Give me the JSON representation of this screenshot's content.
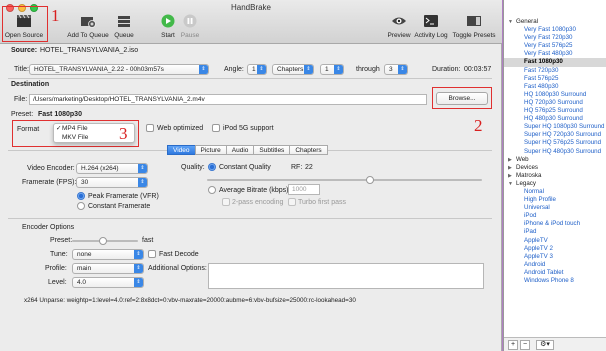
{
  "window": {
    "title": "HandBrake"
  },
  "toolbar": {
    "open_source": "Open Source",
    "add_to_queue": "Add To Queue",
    "queue": "Queue",
    "start": "Start",
    "pause": "Pause",
    "preview": "Preview",
    "activity_log": "Activity Log",
    "toggle_presets": "Toggle Presets"
  },
  "annotations": {
    "n1": "1",
    "n2": "2",
    "n3": "3"
  },
  "source": {
    "label": "Source:",
    "value": "HOTEL_TRANSYLVANIA_2.iso"
  },
  "title_row": {
    "title_label": "Title:",
    "title_value": "HOTEL_TRANSYLVANIA_2.22 - 00h03m57s",
    "angle_label": "Angle:",
    "angle_value": "1",
    "chapters_value": "Chapters",
    "from_value": "1",
    "through_label": "through",
    "to_value": "3",
    "duration_label": "Duration:",
    "duration_value": "00:03:57"
  },
  "destination": {
    "section": "Destination",
    "file_label": "File:",
    "file_value": "/Users/marketing/Desktop/HOTEL_TRANSYLVANIA_2.m4v",
    "browse": "Browse..."
  },
  "preset": {
    "label": "Preset:",
    "value": "Fast 1080p30"
  },
  "format": {
    "label": "Format",
    "menu": [
      {
        "label": "MP4 File",
        "checked": "✓"
      },
      {
        "label": "MKV File",
        "checked": ""
      }
    ],
    "web_optimized": "Web optimized",
    "ipod": "iPod 5G support"
  },
  "tabs": [
    "Video",
    "Picture",
    "Audio",
    "Subtitles",
    "Chapters"
  ],
  "video": {
    "encoder_label": "Video Encoder:",
    "encoder_value": "H.264 (x264)",
    "framerate_label": "Framerate (FPS):",
    "framerate_value": "30",
    "peak": "Peak Framerate (VFR)",
    "constant_fr": "Constant Framerate",
    "quality_label": "Quality:",
    "constant_quality": "Constant Quality",
    "rf_label": "RF:",
    "rf_value": "22",
    "avg_bitrate": "Average Bitrate (kbps):",
    "bitrate_value": "1000",
    "two_pass": "2-pass encoding",
    "turbo": "Turbo first pass"
  },
  "encoder": {
    "section": "Encoder Options",
    "preset_label": "Preset:",
    "preset_slider_label": "fast",
    "tune_label": "Tune:",
    "tune_value": "none",
    "fast_decode": "Fast Decode",
    "profile_label": "Profile:",
    "profile_value": "main",
    "additional_label": "Additional Options:",
    "level_label": "Level:",
    "level_value": "4.0",
    "unparse": "x264 Unparse: weightp=1:level=4.0:ref=2:8x8dct=0:vbv-maxrate=20000:aubme=6:vbv-bufsize=25000:rc-lookahead=30"
  },
  "presets": [
    {
      "type": "grp",
      "label": "General",
      "open": "▼"
    },
    {
      "type": "leaf",
      "label": "Very Fast 1080p30"
    },
    {
      "type": "leaf",
      "label": "Very Fast 720p30"
    },
    {
      "type": "leaf",
      "label": "Very Fast 576p25"
    },
    {
      "type": "leaf",
      "label": "Very Fast 480p30"
    },
    {
      "type": "leaf",
      "label": "Fast 1080p30",
      "selected": true
    },
    {
      "type": "leaf",
      "label": "Fast 720p30"
    },
    {
      "type": "leaf",
      "label": "Fast 576p25"
    },
    {
      "type": "leaf",
      "label": "Fast 480p30"
    },
    {
      "type": "leaf",
      "label": "HQ 1080p30 Surround"
    },
    {
      "type": "leaf",
      "label": "HQ 720p30 Surround"
    },
    {
      "type": "leaf",
      "label": "HQ 576p25 Surround"
    },
    {
      "type": "leaf",
      "label": "HQ 480p30 Surround"
    },
    {
      "type": "leaf",
      "label": "Super HQ 1080p30 Surround"
    },
    {
      "type": "leaf",
      "label": "Super HQ 720p30 Surround"
    },
    {
      "type": "leaf",
      "label": "Super HQ 576p25 Surround"
    },
    {
      "type": "leaf",
      "label": "Super HQ 480p30 Surround"
    },
    {
      "type": "grp",
      "label": "Web",
      "open": "▶"
    },
    {
      "type": "grp",
      "label": "Devices",
      "open": "▶"
    },
    {
      "type": "grp",
      "label": "Matroska",
      "open": "▶"
    },
    {
      "type": "grp",
      "label": "Legacy",
      "open": "▼"
    },
    {
      "type": "leaf",
      "label": "Normal"
    },
    {
      "type": "leaf",
      "label": "High Profile"
    },
    {
      "type": "leaf",
      "label": "Universal"
    },
    {
      "type": "leaf",
      "label": "iPod"
    },
    {
      "type": "leaf",
      "label": "iPhone & iPod touch"
    },
    {
      "type": "leaf",
      "label": "iPad"
    },
    {
      "type": "leaf",
      "label": "AppleTV"
    },
    {
      "type": "leaf",
      "label": "AppleTV 2"
    },
    {
      "type": "leaf",
      "label": "AppleTV 3"
    },
    {
      "type": "leaf",
      "label": "Android"
    },
    {
      "type": "leaf",
      "label": "Android Tablet"
    },
    {
      "type": "leaf",
      "label": "Windows Phone 8"
    }
  ],
  "sidebar_buttons": {
    "add": "+",
    "remove": "−",
    "gear": "⚙▾"
  },
  "colors": {
    "accent": "#2f7ae0",
    "annotation": "#e03030",
    "preset_link": "#1e5fc8"
  }
}
